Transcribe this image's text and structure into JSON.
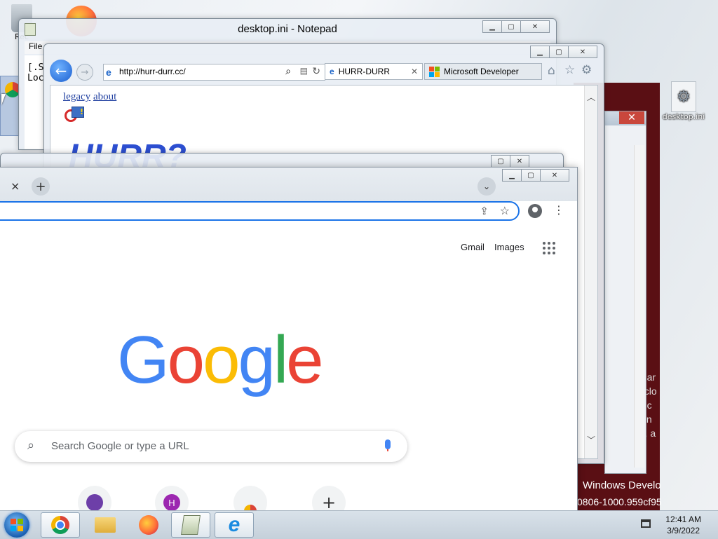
{
  "desktop": {
    "recycle_label": "Rec",
    "ini_label": "desktop.ini"
  },
  "dev_window": {
    "title": "Windows Develo",
    "code": "0806-1000.959cf95",
    "clipped_lines": [
      "mar",
      "nclo",
      "e c",
      "ien",
      "f), a"
    ]
  },
  "notepad": {
    "title": "desktop.ini - Notepad",
    "menu_first": "File",
    "lines": "[.S\nLoc"
  },
  "ie": {
    "url": "http://hurr-durr.cc/",
    "tabs": [
      {
        "label": "HURR-DURR"
      },
      {
        "label": "Microsoft Developer"
      }
    ],
    "links": {
      "legacy": "legacy",
      "about": "about"
    },
    "heading_partial": "HURR?"
  },
  "chrome": {
    "tab_close": "×",
    "new_tab": "+",
    "gmail": "Gmail",
    "images": "Images",
    "logo": [
      "G",
      "o",
      "o",
      "g",
      "l",
      "e"
    ],
    "logo_colors": [
      "#4285F4",
      "#EA4335",
      "#FBBC05",
      "#4285F4",
      "#34A853",
      "#EA4335"
    ],
    "search_placeholder": "Search Google or type a URL",
    "shortcut_h": "H",
    "add_shortcut": "+"
  },
  "taskbar": {
    "time": "12:41 AM",
    "date": "3/9/2022"
  },
  "colors": {
    "chrome_focus": "#1a73e8",
    "dev_window_bg": "#5a0f14"
  }
}
